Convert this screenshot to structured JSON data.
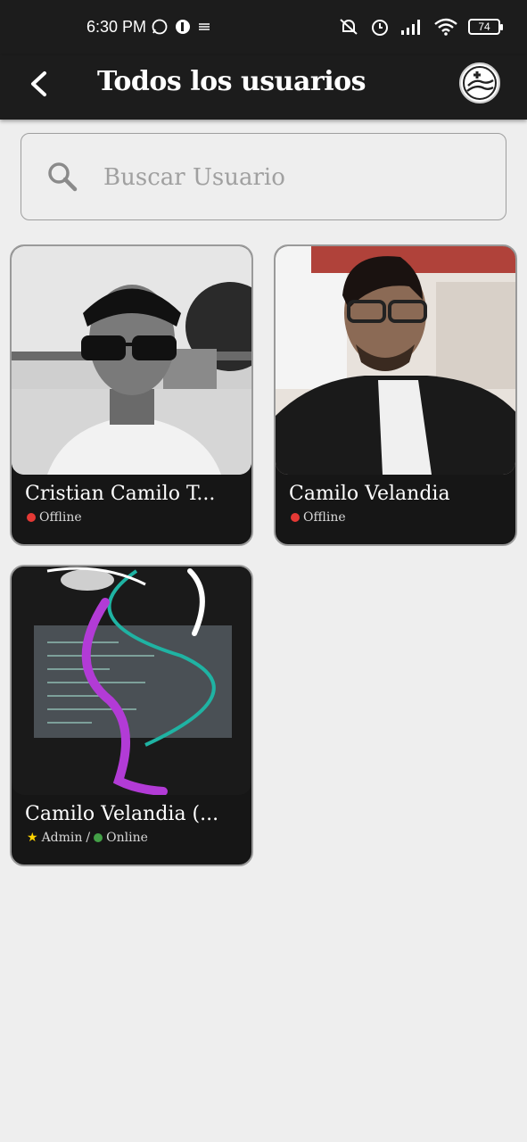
{
  "statusbar": {
    "time": "6:30 PM",
    "battery": "74",
    "icons": [
      "whatsapp-icon",
      "app-icon",
      "notes-icon",
      "mute-icon",
      "alarm-icon",
      "signal-icon",
      "wifi-icon"
    ]
  },
  "appbar": {
    "title": "Todos los usuarios",
    "back_icon": "back-arrow-icon",
    "action_icon": "add-church-icon"
  },
  "search": {
    "placeholder": "Buscar Usuario",
    "value": ""
  },
  "colors": {
    "offline": "#e53935",
    "online": "#43a047",
    "admin_star": "#ffd400",
    "background": "#eeeeee",
    "card": "#161616"
  },
  "users": [
    {
      "name": "Cristian Camilo T...",
      "status": "Offline"
    },
    {
      "name": "Camilo Velandia",
      "status": "Offline"
    },
    {
      "name": "Camilo Velandia (...",
      "role": "Admin",
      "separator": "/",
      "status": "Online"
    }
  ]
}
